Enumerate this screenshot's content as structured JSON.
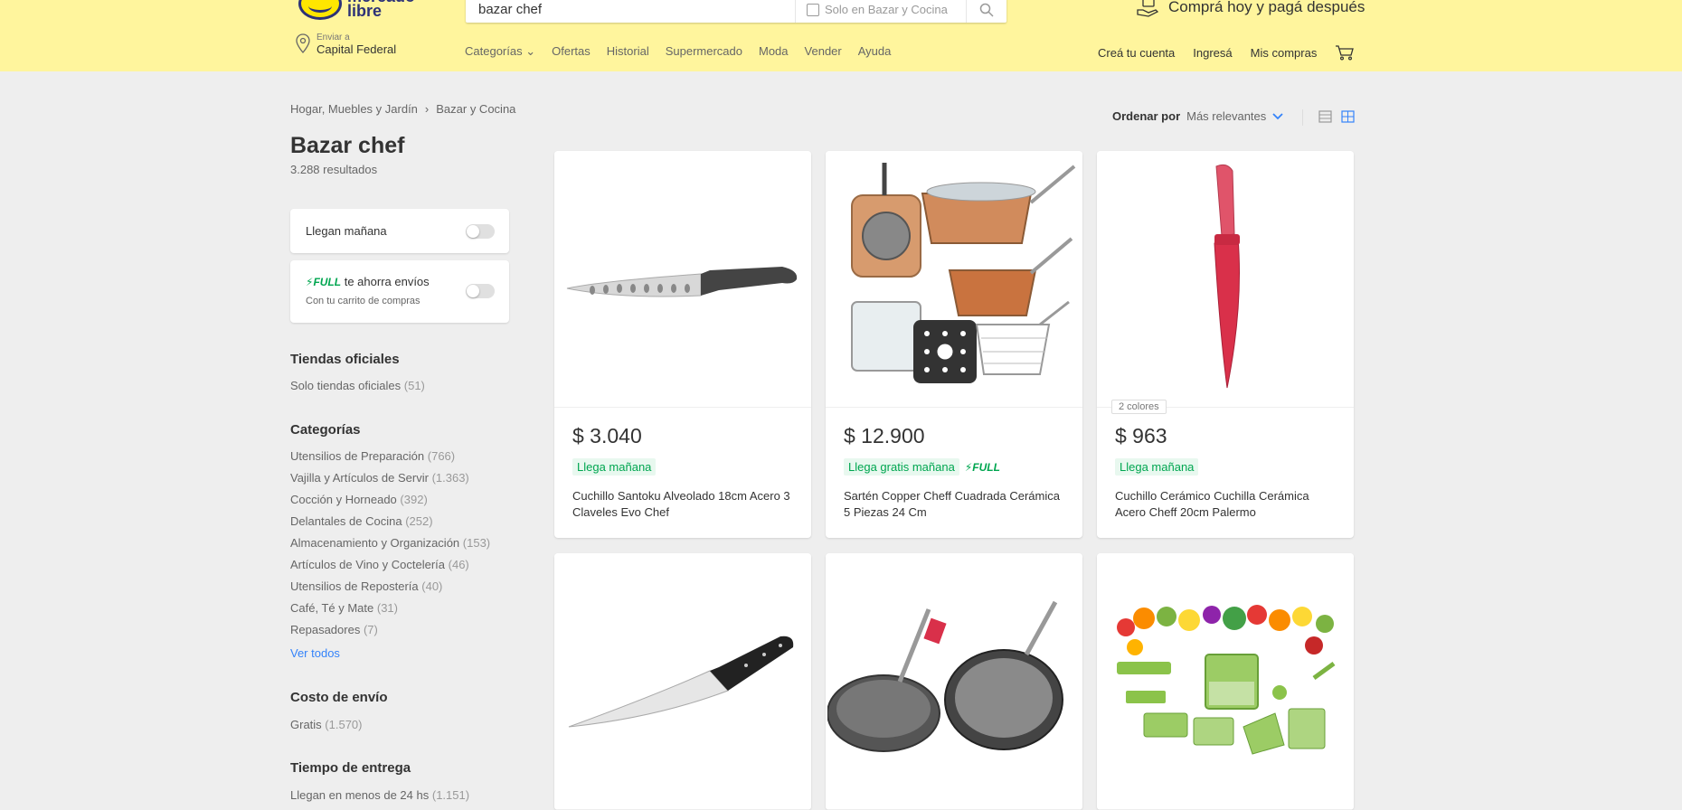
{
  "header": {
    "logo_text_1": "mercado",
    "logo_text_2": "libre",
    "search_value": "bazar chef",
    "search_scope": "Solo en Bazar y Cocina",
    "promo": "Comprá hoy y pagá después",
    "location_label": "Enviar a",
    "location_value": "Capital Federal",
    "nav": [
      "Categorías",
      "Ofertas",
      "Historial",
      "Supermercado",
      "Moda",
      "Vender",
      "Ayuda"
    ],
    "account": [
      "Creá tu cuenta",
      "Ingresá",
      "Mis compras"
    ]
  },
  "breadcrumb": [
    "Hogar, Muebles y Jardín",
    "Bazar y Cocina"
  ],
  "page_title": "Bazar chef",
  "results_count": "3.288 resultados",
  "filters": {
    "tomorrow_label": "Llegan mañana",
    "full_badge": "FULL",
    "full_label": "te ahorra envíos",
    "full_sub": "Con tu carrito de compras"
  },
  "sections": {
    "official_title": "Tiendas oficiales",
    "official_items": [
      {
        "label": "Solo tiendas oficiales",
        "count": "(51)"
      }
    ],
    "categories_title": "Categorías",
    "categories": [
      {
        "label": "Utensilios de Preparación",
        "count": "(766)"
      },
      {
        "label": "Vajilla y Artículos de Servir",
        "count": "(1.363)"
      },
      {
        "label": "Cocción y Horneado",
        "count": "(392)"
      },
      {
        "label": "Delantales de Cocina",
        "count": "(252)"
      },
      {
        "label": "Almacenamiento y Organización",
        "count": "(153)"
      },
      {
        "label": "Artículos de Vino y Coctelería",
        "count": "(46)"
      },
      {
        "label": "Utensilios de Repostería",
        "count": "(40)"
      },
      {
        "label": "Café, Té y Mate",
        "count": "(31)"
      },
      {
        "label": "Repasadores",
        "count": "(7)"
      }
    ],
    "see_all": "Ver todos",
    "shipping_title": "Costo de envío",
    "shipping_items": [
      {
        "label": "Gratis",
        "count": "(1.570)"
      }
    ],
    "delivery_title": "Tiempo de entrega",
    "delivery_items": [
      {
        "label": "Llegan en menos de 24 hs",
        "count": "(1.151)"
      }
    ]
  },
  "sort": {
    "label": "Ordenar por",
    "value": "Más relevantes"
  },
  "products": [
    {
      "price": "$ 3.040",
      "shipping": "Llega mañana",
      "full": "",
      "title": "Cuchillo Santoku Alveolado 18cm Acero 3 Claveles Evo Chef",
      "colors": ""
    },
    {
      "price": "$ 12.900",
      "shipping": "Llega gratis mañana",
      "full": "FULL",
      "title": "Sartén Copper Cheff Cuadrada Cerámica 5 Piezas 24 Cm",
      "colors": ""
    },
    {
      "price": "$ 963",
      "shipping": "Llega mañana",
      "full": "",
      "title": "Cuchillo Cerámico Cuchilla Cerámica Acero Cheff 20cm Palermo",
      "colors": "2 colores"
    }
  ],
  "colors": {
    "header_bg": "#fff59d",
    "accent_blue": "#3483fa",
    "green": "#00a650"
  }
}
